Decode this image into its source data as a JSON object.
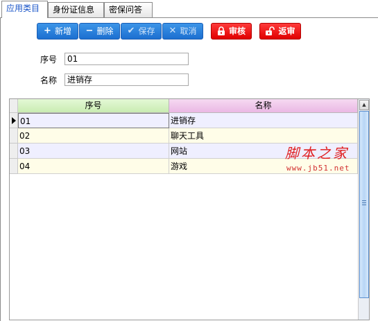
{
  "tabs": [
    {
      "label": "应用类目",
      "active": true
    },
    {
      "label": "身份证信息",
      "active": false
    },
    {
      "label": "密保问答",
      "active": false
    }
  ],
  "toolbar": {
    "add": {
      "label": "新增",
      "icon": "plus-icon"
    },
    "delete": {
      "label": "删除",
      "icon": "minus-icon"
    },
    "save": {
      "label": "保存",
      "icon": "check-icon"
    },
    "cancel": {
      "label": "取消",
      "icon": "x-icon"
    },
    "audit": {
      "label": "审核",
      "icon": "lock-icon"
    },
    "unaudit": {
      "label": "返审",
      "icon": "unlock-icon"
    }
  },
  "form": {
    "seq_label": "序号",
    "seq_value": "01",
    "name_label": "名称",
    "name_value": "进销存"
  },
  "grid": {
    "columns": [
      "序号",
      "名称"
    ],
    "rows": [
      [
        "01",
        "进销存"
      ],
      [
        "02",
        "聊天工具"
      ],
      [
        "03",
        "网站"
      ],
      [
        "04",
        "游戏"
      ]
    ],
    "row_colors": [
      "#efefff",
      "#fffde8",
      "#efefff",
      "#fffde8"
    ],
    "header_colors": [
      "#c9ecb2",
      "#eab8e4"
    ]
  },
  "watermark": {
    "title": "脚本之家",
    "url": "www.jb51.net"
  },
  "colors": {
    "primary_button": "#1c6fd0",
    "danger_button": "#e00000",
    "active_tab_text": "#1a55c8"
  }
}
